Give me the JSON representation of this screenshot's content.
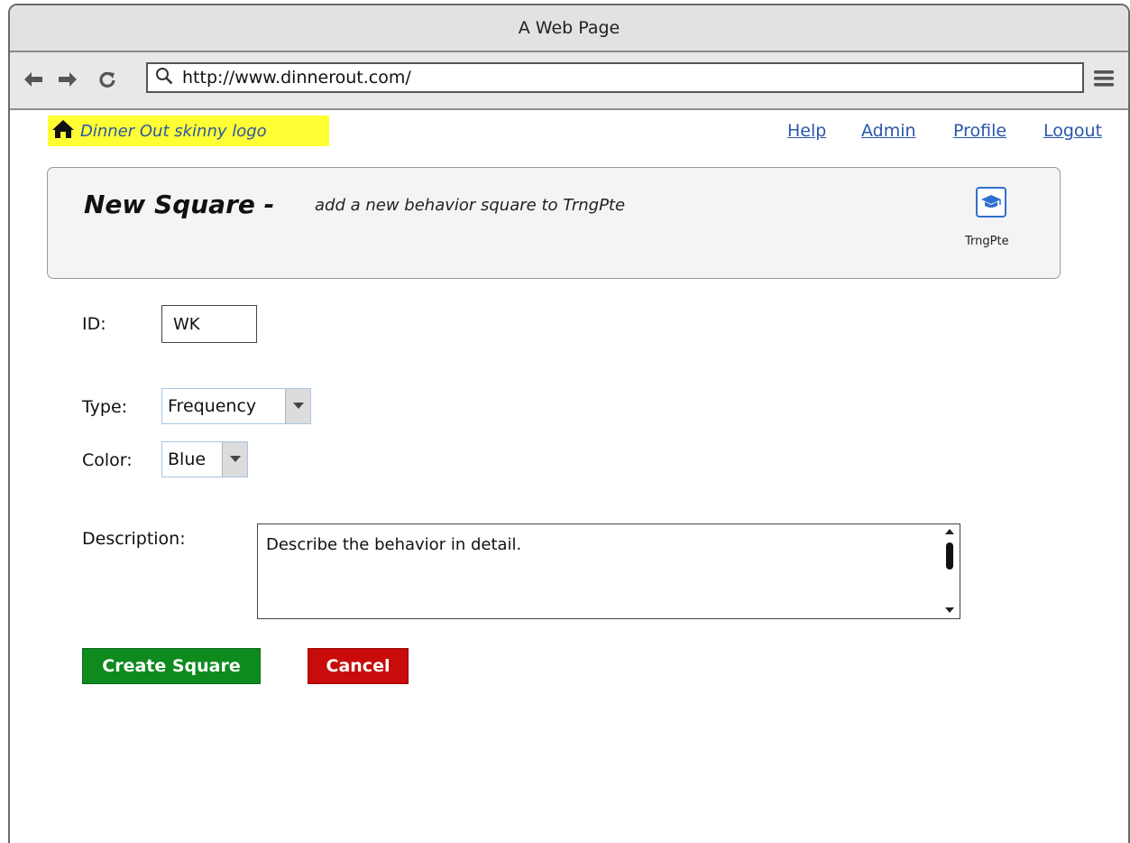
{
  "window": {
    "title": "A Web Page"
  },
  "browser": {
    "url": "http://www.dinnerout.com/",
    "icons": [
      "back-arrow-icon",
      "forward-arrow-icon",
      "refresh-icon",
      "search-icon",
      "hamburger-menu-icon"
    ]
  },
  "header": {
    "logo_text": "Dinner Out skinny logo",
    "links": [
      {
        "label": "Help"
      },
      {
        "label": "Admin"
      },
      {
        "label": "Profile"
      },
      {
        "label": "Logout"
      }
    ]
  },
  "banner": {
    "title": "New Square -",
    "subtitle": "add a new behavior square to TrngPte",
    "badge_label": "TrngPte",
    "icon_color": "#2f6fd0"
  },
  "form": {
    "id_label": "ID:",
    "id_value": "WK",
    "type_label": "Type:",
    "type_value": "Frequency",
    "color_label": "Color:",
    "color_value": "Blue",
    "description_label": "Description:",
    "description_placeholder": "Describe the behavior in detail."
  },
  "actions": {
    "create_label": "Create Square",
    "cancel_label": "Cancel",
    "create_color": "#0e8a1f",
    "cancel_color": "#c80b0b"
  },
  "colors": {
    "link": "#2a56a8",
    "logo_bg": "#ffff33"
  }
}
